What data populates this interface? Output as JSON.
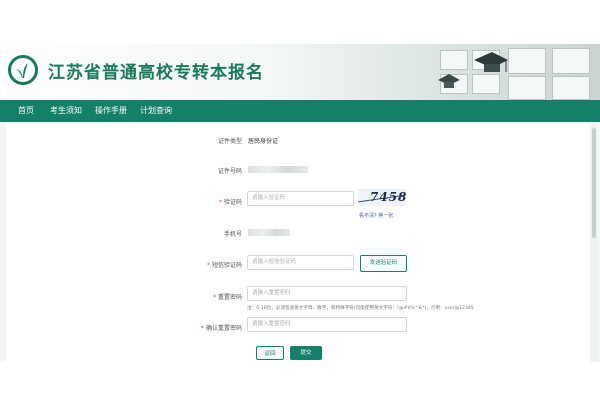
{
  "header": {
    "site_title": "江苏省普通高校专转本报名"
  },
  "nav": {
    "items": [
      {
        "label": "首页"
      },
      {
        "label": "考生须知"
      },
      {
        "label": "操作手册"
      },
      {
        "label": "计划查询"
      }
    ]
  },
  "form": {
    "id_type": {
      "label": "证件类型",
      "value": "居民身份证"
    },
    "id_number": {
      "label": "证件号码"
    },
    "captcha": {
      "label": "验证码",
      "placeholder": "请输入验证码",
      "image_text": "7458",
      "refresh_link": "看不清? 换一张"
    },
    "phone": {
      "label": "手机号"
    },
    "sms_code": {
      "label": "短信验证码",
      "placeholder": "请输入短信验证码",
      "send_button": "发送验证码"
    },
    "new_password": {
      "label": "重置密码",
      "placeholder": "请输入重置密码",
      "hint": "注：6-16位，必须包含英文字母、数字，和特殊字符(仅能使用英文字符：!@#$%^&*)，示例：user@12345"
    },
    "confirm_password": {
      "label": "确认重置密码",
      "placeholder": "请输入重置密码"
    },
    "back_button": "返回",
    "submit_button": "提交"
  }
}
